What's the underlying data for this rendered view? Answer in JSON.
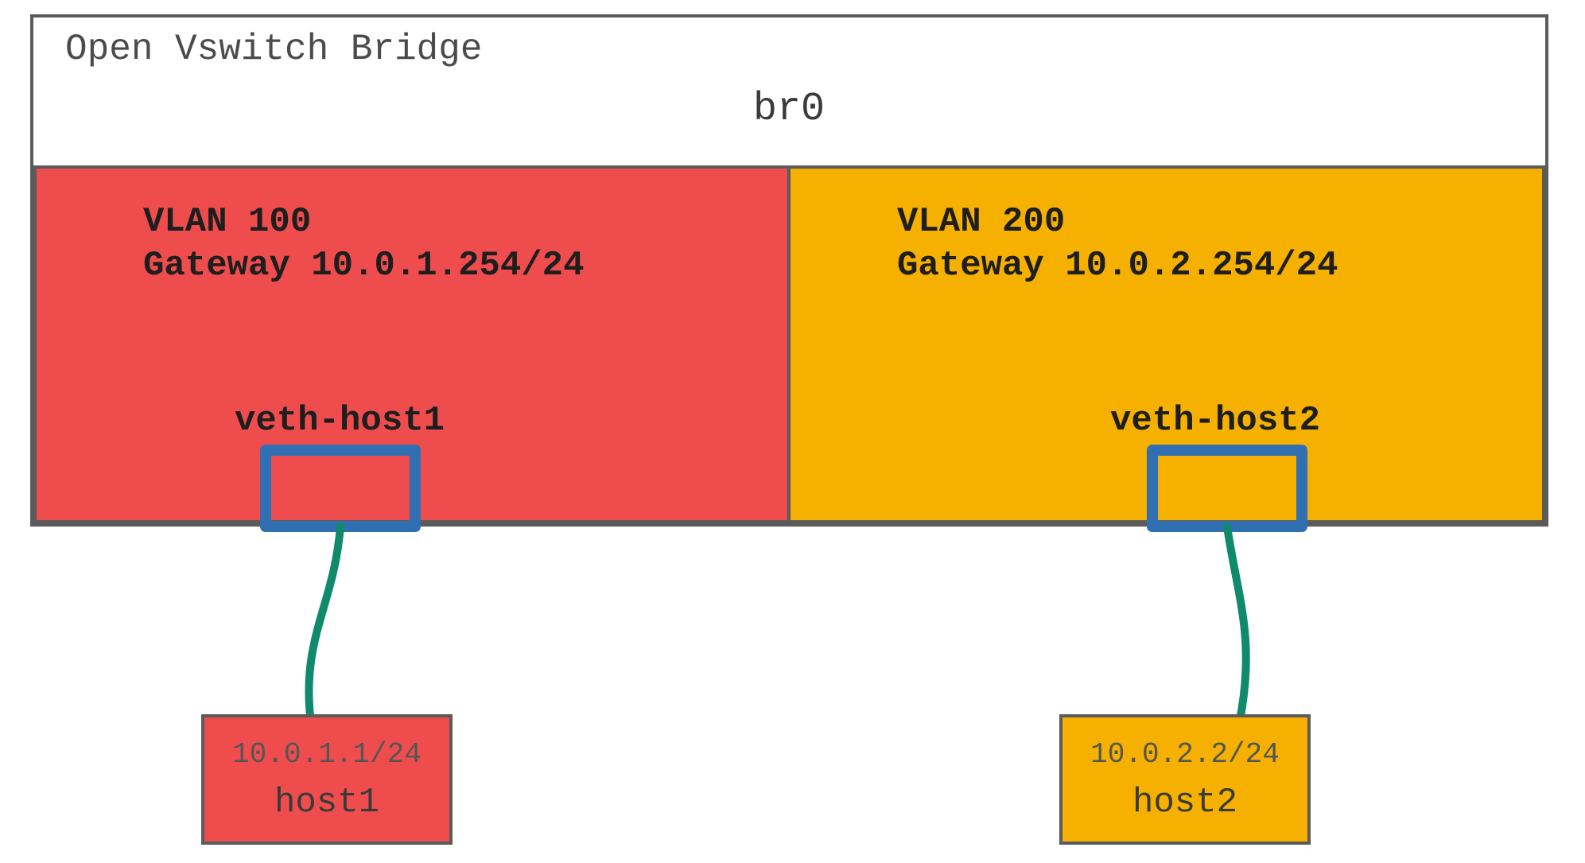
{
  "title": "Open Vswitch Bridge",
  "bridge_name": "br0",
  "colors": {
    "vlan100": "#ef4d4d",
    "vlan200": "#f5b000",
    "port_stroke": "#2f6fb2",
    "link_stroke": "#0f8a6b",
    "border": "#5b5b5b"
  },
  "vlans": [
    {
      "id": "vlan100",
      "label_line1": "VLAN 100",
      "label_line2": "Gateway 10.0.1.254/24",
      "veth_label": "veth-host1",
      "host": {
        "ip": "10.0.1.1/24",
        "name": "host1"
      }
    },
    {
      "id": "vlan200",
      "label_line1": "VLAN 200",
      "label_line2": "Gateway 10.0.2.254/24",
      "veth_label": "veth-host2",
      "host": {
        "ip": "10.0.2.2/24",
        "name": "host2"
      }
    }
  ]
}
